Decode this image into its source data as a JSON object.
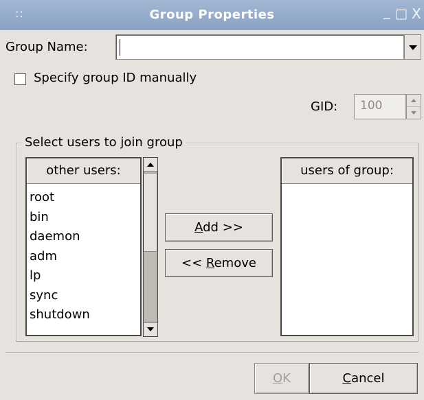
{
  "window": {
    "title": "Group Properties",
    "grip_glyph": "::",
    "minimize_glyph": "_",
    "maximize_glyph": "□",
    "close_glyph": "X"
  },
  "group_name": {
    "label": "Group Name:",
    "value": ""
  },
  "specify_gid": {
    "label": "Specify group ID manually",
    "checked": false
  },
  "gid": {
    "label": "GID:",
    "value": "100"
  },
  "frame": {
    "title": "Select users to join group"
  },
  "other_users": {
    "header": "other users:",
    "items": [
      "root",
      "bin",
      "daemon",
      "adm",
      "lp",
      "sync",
      "shutdown"
    ]
  },
  "group_users": {
    "header": "users of group:",
    "items": []
  },
  "buttons": {
    "add_mnemonic": "A",
    "add_rest": "dd >>",
    "remove_prefix": "<< ",
    "remove_mnemonic": "R",
    "remove_rest": "emove",
    "ok_mnemonic": "O",
    "ok_rest": "K",
    "cancel_mnemonic": "C",
    "cancel_rest": "ancel"
  },
  "colors": {
    "titlebar": "#8aa2c6",
    "window_bg": "#e6e3df",
    "disabled_text": "#a3a09c"
  }
}
